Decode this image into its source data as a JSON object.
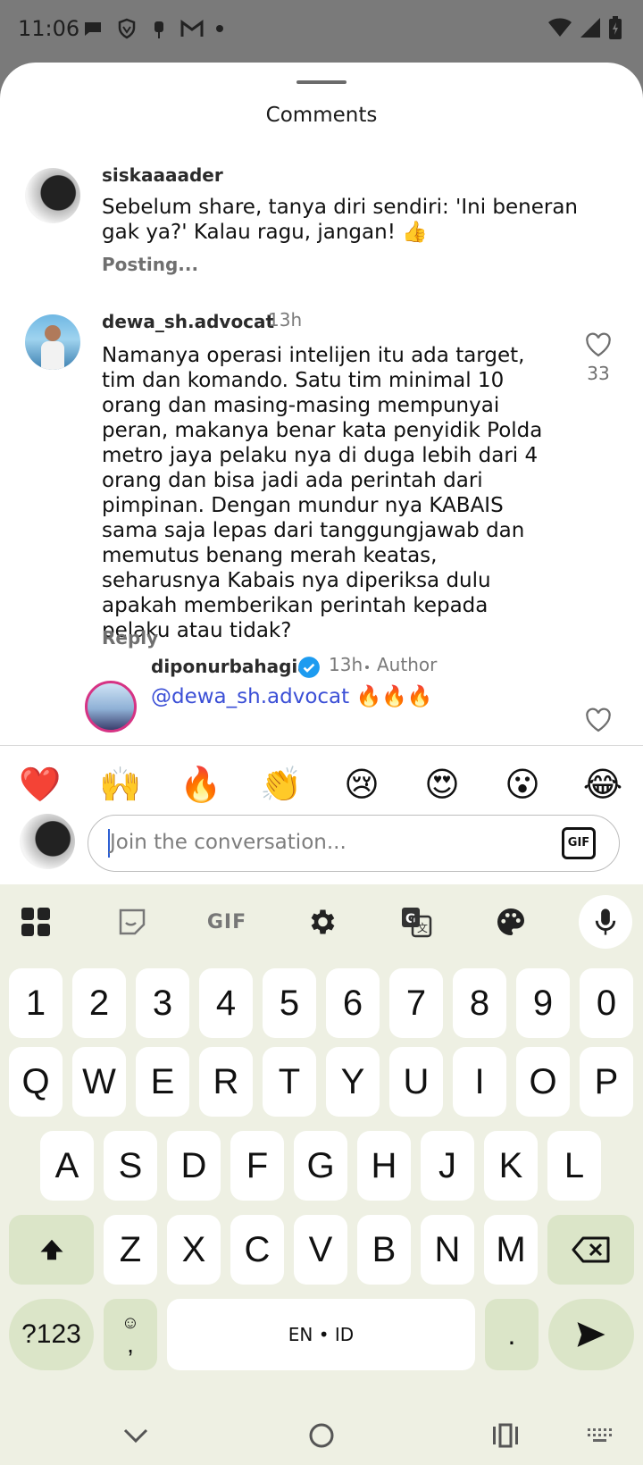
{
  "status_bar": {
    "time": "11:06"
  },
  "sheet": {
    "title": "Comments"
  },
  "comments": [
    {
      "username": "siskaaaader",
      "text": "Sebelum share, tanya diri sendiri: 'Ini beneran gak ya?' Kalau ragu, jangan! 👍",
      "status": "Posting..."
    },
    {
      "username": "dewa_sh.advocat",
      "time": "13h",
      "text": "Namanya operasi intelijen itu ada target, tim dan komando. Satu tim minimal 10 orang dan masing-masing mempunyai peran, makanya benar kata penyidik Polda metro jaya pelaku nya di duga lebih dari 4 orang dan bisa jadi ada perintah dari pimpinan. Dengan mundur nya KABAIS sama saja lepas dari tanggungjawab dan memutus benang merah keatas, seharusnya Kabais nya diperiksa dulu apakah memberikan perintah kepada pelaku atau tidak?",
      "reply_label": "Reply",
      "likes": "33"
    },
    {
      "username": "diponurbahagia",
      "time": "13h",
      "author_label": "Author",
      "mention": "@dewa_sh.advocat",
      "text": "🔥🔥🔥"
    }
  ],
  "emoji_bar": [
    "❤️",
    "🙌",
    "🔥",
    "👏",
    "😢",
    "😍",
    "😮",
    "😂"
  ],
  "composer": {
    "placeholder": "Join the conversation...",
    "gif_label": "GIF"
  },
  "keyboard": {
    "toolbar_gif": "GIF",
    "row_numbers": [
      "1",
      "2",
      "3",
      "4",
      "5",
      "6",
      "7",
      "8",
      "9",
      "0"
    ],
    "row1": [
      "Q",
      "W",
      "E",
      "R",
      "T",
      "Y",
      "U",
      "I",
      "O",
      "P"
    ],
    "row2": [
      "A",
      "S",
      "D",
      "F",
      "G",
      "H",
      "J",
      "K",
      "L"
    ],
    "row3": [
      "Z",
      "X",
      "C",
      "V",
      "B",
      "N",
      "M"
    ],
    "symbols_label": "?123",
    "emoji_comma": ",",
    "space_label": "EN • ID",
    "period": "."
  },
  "colors": {
    "accent_green": "#dbe5c8",
    "keyboard_bg": "#eef0e3",
    "mention_blue": "#3b4fd6",
    "verified_blue": "#1d9bf0"
  }
}
